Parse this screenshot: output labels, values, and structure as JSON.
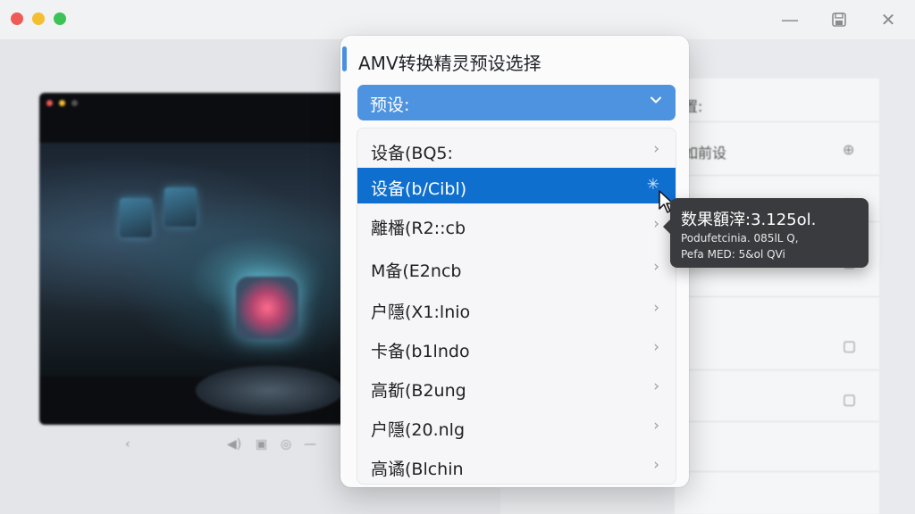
{
  "window": {
    "controls": {
      "minimize_icon": "minus-icon",
      "save_icon": "save-icon",
      "close_icon": "close-icon"
    }
  },
  "dialog": {
    "title": "AMV转换精灵预设选择",
    "select_label": "预设:",
    "select_icon": "chevron-down-icon",
    "items": [
      {
        "label": "设备(BQ5:"
      },
      {
        "label": "设备(b/Cibl)"
      },
      {
        "label": "離橎(R2::cb"
      },
      {
        "label": "M备(E2ncb"
      },
      {
        "label": "户隱(X1:lnio"
      },
      {
        "label": "卡备(b1lndo"
      },
      {
        "label": "高斱(B2ung"
      },
      {
        "label": "户隱(20.nlg"
      },
      {
        "label": "高谲(Blchin"
      }
    ],
    "selected_index": 1,
    "colors": {
      "accent": "#4d93e0",
      "selected": "#0f6fcf"
    }
  },
  "tooltip": {
    "title": "数果額滓:3.125ol.",
    "line1": "Podufetcinia. 085lL Q,",
    "line2": "Pefa MED: 5&ol QVi"
  },
  "side_panel": {
    "rows": [
      {
        "label": "置:",
        "icon": ""
      },
      {
        "label": "如前设",
        "icon": "⊕"
      },
      {
        "label": "",
        "icon": "▢"
      },
      {
        "label": "",
        "icon": "▢"
      },
      {
        "label": "",
        "icon": "▢"
      },
      {
        "label": "",
        "icon": "▢"
      },
      {
        "label": "",
        "icon": "▢"
      }
    ]
  }
}
